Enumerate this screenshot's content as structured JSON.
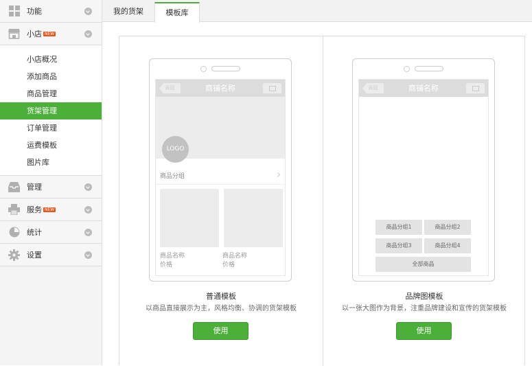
{
  "sidebar": {
    "sections": [
      {
        "label": "功能",
        "icon": "grid-icon"
      },
      {
        "label": "小店",
        "icon": "store-icon",
        "badge": "NEW"
      }
    ],
    "shop_items": [
      "小店概况",
      "添加商品",
      "商品管理",
      "货架管理",
      "订单管理",
      "运费模板",
      "图片库"
    ],
    "active_item": "货架管理",
    "bottom_sections": [
      {
        "label": "管理",
        "icon": "inbox-icon"
      },
      {
        "label": "服务",
        "icon": "printer-icon",
        "badge": "NEW"
      },
      {
        "label": "统计",
        "icon": "pie-chart-icon"
      },
      {
        "label": "设置",
        "icon": "gear-icon"
      }
    ]
  },
  "tabs": {
    "my_shelves": "我的货架",
    "template_library": "模板库",
    "active": "模板库"
  },
  "templates": [
    {
      "name": "普通模板",
      "description": "以商品直接展示为主，风格均衡、协调的货架模板",
      "use_label": "使用",
      "preview": {
        "back": "返回",
        "shop_name": "商铺名称",
        "logo": "LOGO",
        "group_label": "商品分组",
        "products": [
          {
            "name": "商品名称",
            "price": "价格"
          },
          {
            "name": "商品名称",
            "price": "价格"
          }
        ]
      }
    },
    {
      "name": "品牌图模板",
      "description": "以一张大图作为背景，注重品牌建设和宣传的货架模板",
      "use_label": "使用",
      "preview": {
        "back": "返回",
        "shop_name": "商铺名称",
        "groups": [
          "商品分组1",
          "商品分组2",
          "商品分组3",
          "商品分组4"
        ],
        "all_products": "全部商品"
      }
    }
  ],
  "colors": {
    "accent": "#4caf3a",
    "badge": "#e8541e"
  }
}
